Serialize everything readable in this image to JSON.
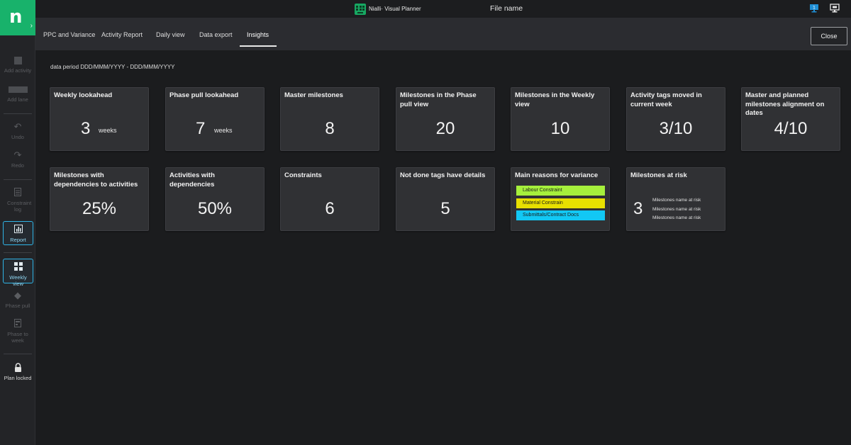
{
  "app": {
    "brand": "Nialli· Visual Planner",
    "file_name": "File name",
    "logo_letter": "n",
    "logo_chevron": "›"
  },
  "sidebar": {
    "items": [
      {
        "label": "Add activity",
        "icon": "add-activity-icon",
        "enabled": false
      },
      {
        "label": "Add lane",
        "icon": "add-lane-icon",
        "enabled": false
      },
      {
        "label": "Undo",
        "icon": "undo-icon",
        "enabled": false
      },
      {
        "label": "Redo",
        "icon": "redo-icon",
        "enabled": false
      },
      {
        "label": "Constraint log",
        "icon": "constraint-log-icon",
        "enabled": false
      },
      {
        "label": "Report",
        "icon": "report-icon",
        "enabled": true,
        "selected": true
      },
      {
        "label": "Weekly view",
        "icon": "weekly-view-icon",
        "enabled": true,
        "selected": true
      },
      {
        "label": "Phase pull",
        "icon": "phase-pull-icon",
        "enabled": false
      },
      {
        "label": "Phase to week",
        "icon": "phase-to-week-icon",
        "enabled": false
      },
      {
        "label": "Plan locked",
        "icon": "lock-icon",
        "enabled": true
      }
    ]
  },
  "tabs": [
    {
      "label": "PPC and Variance"
    },
    {
      "label": "Activity Report"
    },
    {
      "label": "Daily view"
    },
    {
      "label": "Data export"
    },
    {
      "label": "Insights",
      "active": true
    }
  ],
  "close_label": "Close",
  "period_text": "data period DDD/MMM/YYYY - DDD/MMM/YYYY",
  "cards": {
    "weekly_lookahead": {
      "title": "Weekly lookahead",
      "value": "3",
      "unit": "weeks"
    },
    "phase_pull_lookahead": {
      "title": "Phase pull lookahead",
      "value": "7",
      "unit": "weeks"
    },
    "master_milestones": {
      "title": "Master milestones",
      "value": "8"
    },
    "milestones_phase_pull": {
      "title": "Milestones in the Phase pull view",
      "value": "20"
    },
    "milestones_weekly": {
      "title": "Milestones in the Weekly view",
      "value": "10"
    },
    "activity_tags_moved": {
      "title": "Activity tags moved in current week",
      "value": "3/10"
    },
    "master_planned_alignment": {
      "title": "Master and planned milestones alignment on dates",
      "value": "4/10"
    },
    "milestones_dependencies": {
      "title": "Milestones with dependencies to activities",
      "value": "25%"
    },
    "activities_dependencies": {
      "title": "Activities with dependencies",
      "value": "50%"
    },
    "constraints": {
      "title": "Constraints",
      "value": "6"
    },
    "not_done_tags": {
      "title": "Not done tags have details",
      "value": "5"
    },
    "variance_reasons": {
      "title": "Main reasons for variance",
      "reasons": [
        {
          "label": "Labour Constraint",
          "color": "#a6f03c"
        },
        {
          "label": "Material Constrain",
          "color": "#e8e000"
        },
        {
          "label": "Submittals/Contract Docs",
          "color": "#12c8f4"
        }
      ]
    },
    "milestones_at_risk": {
      "title": "Milestones at risk",
      "value": "3",
      "items": [
        "Milestones name  at risk",
        "Milestones name at risk",
        "Milestones name at risk"
      ]
    }
  },
  "colors": {
    "accent_green": "#18b26b",
    "selected_border": "#2fb4e6",
    "background": "#1b1c1e",
    "card": "#303134"
  }
}
